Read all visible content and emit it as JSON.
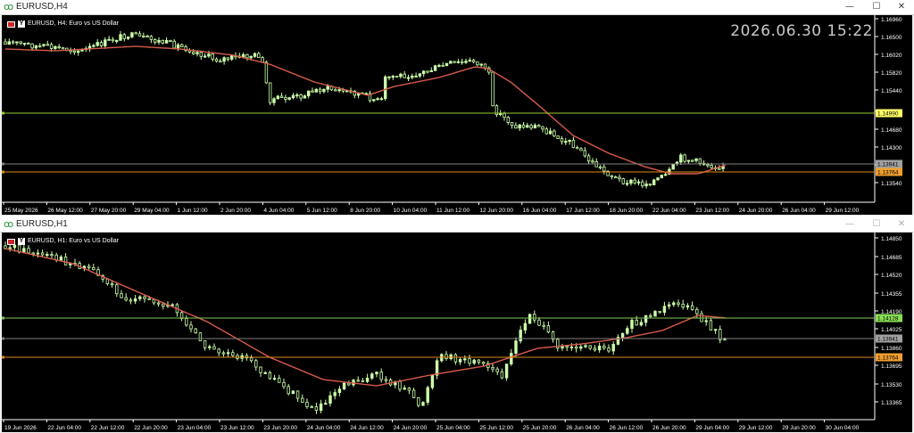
{
  "top": {
    "window_title": "EURUSD,H4",
    "symbol_label": "EURUSD, H4:  Euro vs US Dollar",
    "clock": "2026.06.30 15:22",
    "y_ticks": [
      "1.16960",
      "1.16500",
      "1.16020",
      "1.15820",
      "1.15440",
      "1.14990",
      "1.14680",
      "1.14300",
      "1.13900",
      "1.13540"
    ],
    "x_ticks": [
      "25 May 2026",
      "26 May 12:00",
      "27 May 20:00",
      "29 May 04:00",
      "1 Jun 12:00",
      "2 Jun 20:00",
      "4 Jun 04:00",
      "5 Jun 12:00",
      "8 Jun 20:00",
      "10 Jun 04:00",
      "11 Jun 12:00",
      "12 Jun 20:00",
      "16 Jun 04:00",
      "17 Jun 12:00",
      "18 Jun 20:00",
      "22 Jun 04:00",
      "23 Jun 12:00",
      "24 Jun 20:00",
      "26 Jun 04:00",
      "29 Jun 12:00"
    ],
    "price_lines": [
      {
        "label": "1.14990",
        "color": "#9acd32",
        "bg": "#ffff66"
      },
      {
        "label": "1.13941",
        "color": "#808080",
        "bg": "#a0a0a0"
      },
      {
        "label": "1.13764",
        "color": "#e08a1a",
        "bg": "#f0a030"
      }
    ],
    "ma_color": "#d85a4a",
    "candle_color": "#ccffaa"
  },
  "bottom": {
    "window_title": "EURUSD,H1",
    "symbol_label": "EURUSD, H1:  Euro vs US Dollar",
    "y_ticks": [
      "1.14850",
      "1.14685",
      "1.14520",
      "1.14355",
      "1.14190",
      "1.14025",
      "1.13860",
      "1.13695",
      "1.13530",
      "1.13365"
    ],
    "x_ticks": [
      "19 Jun 2026",
      "22 Jun 04:00",
      "22 Jun 12:00",
      "22 Jun 20:00",
      "23 Jun 04:00",
      "23 Jun 12:00",
      "23 Jun 20:00",
      "24 Jun 04:00",
      "24 Jun 12:00",
      "24 Jun 20:00",
      "25 Jun 04:00",
      "25 Jun 12:00",
      "25 Jun 20:00",
      "26 Jun 04:00",
      "26 Jun 12:00",
      "26 Jun 20:00",
      "29 Jun 04:00",
      "29 Jun 12:00",
      "29 Jun 20:00",
      "30 Jun 04:00"
    ],
    "price_lines": [
      {
        "label": "1.14128",
        "color": "#7fc85a",
        "bg": "#88dd55"
      },
      {
        "label": "1.13941",
        "color": "#808080",
        "bg": "#a0a0a0"
      },
      {
        "label": "1.13764",
        "color": "#e08a1a",
        "bg": "#f0a030"
      }
    ],
    "ma_color": "#d85a4a",
    "candle_color": "#ccffaa"
  },
  "window_controls": {
    "minimize": "—",
    "maximize": "☐",
    "close": "✕"
  }
}
